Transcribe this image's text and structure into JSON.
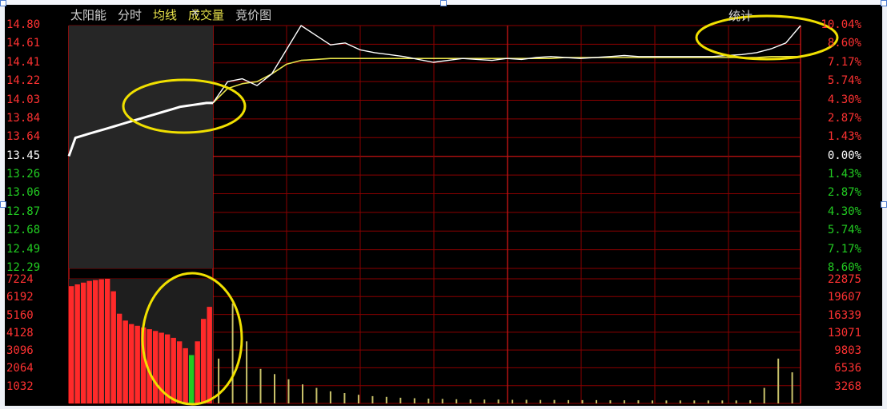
{
  "header": {
    "stock_name": "太阳能",
    "tab_time": "分时",
    "tab_avg": "均线",
    "tab_volume": "成交量",
    "tab_auction": "竞价图",
    "stat_label": "统计",
    "close_symbol": "×"
  },
  "price_axis": {
    "left": [
      {
        "text": "14.80",
        "tone": "red"
      },
      {
        "text": "14.61",
        "tone": "red"
      },
      {
        "text": "14.41",
        "tone": "red"
      },
      {
        "text": "14.22",
        "tone": "red"
      },
      {
        "text": "14.03",
        "tone": "red"
      },
      {
        "text": "13.84",
        "tone": "red"
      },
      {
        "text": "13.64",
        "tone": "red"
      },
      {
        "text": "13.45",
        "tone": "white"
      },
      {
        "text": "13.26",
        "tone": "green"
      },
      {
        "text": "13.06",
        "tone": "green"
      },
      {
        "text": "12.87",
        "tone": "green"
      },
      {
        "text": "12.68",
        "tone": "green"
      },
      {
        "text": "12.49",
        "tone": "green"
      },
      {
        "text": "12.29",
        "tone": "green"
      }
    ],
    "right": [
      {
        "text": "10.04%",
        "tone": "red"
      },
      {
        "text": "8.60%",
        "tone": "red"
      },
      {
        "text": "7.17%",
        "tone": "red"
      },
      {
        "text": "5.74%",
        "tone": "red"
      },
      {
        "text": "4.30%",
        "tone": "red"
      },
      {
        "text": "2.87%",
        "tone": "red"
      },
      {
        "text": "1.43%",
        "tone": "red"
      },
      {
        "text": "0.00%",
        "tone": "white"
      },
      {
        "text": "1.43%",
        "tone": "green"
      },
      {
        "text": "2.87%",
        "tone": "green"
      },
      {
        "text": "4.30%",
        "tone": "green"
      },
      {
        "text": "5.74%",
        "tone": "green"
      },
      {
        "text": "7.17%",
        "tone": "green"
      },
      {
        "text": "8.60%",
        "tone": "green"
      }
    ]
  },
  "volume_axis": {
    "left": [
      "7224",
      "6192",
      "5160",
      "4128",
      "3096",
      "2064",
      "1032"
    ],
    "right": [
      "22875",
      "19607",
      "16339",
      "13071",
      "9803",
      "6536",
      "3268"
    ]
  },
  "colors": {
    "grid": "#8b0000",
    "price_line": "#ffffff",
    "avg_line": "#e8e24a",
    "up_bar": "#ff2a2a",
    "down_bar": "#22cc22",
    "highlight": "#f0e000",
    "vol_bar": "#c9c26a"
  },
  "chart_data": {
    "type": "line",
    "title": "",
    "xlabel": "",
    "ylabel": "",
    "ylim": [
      12.29,
      14.8
    ],
    "prev_close": 13.45,
    "auction_price": [
      13.45,
      13.64,
      13.66,
      13.68,
      13.7,
      13.72,
      13.74,
      13.76,
      13.78,
      13.8,
      13.82,
      13.84,
      13.86,
      13.88,
      13.9,
      13.92,
      13.94,
      13.96,
      13.97,
      13.98,
      13.99,
      14.0,
      14.0
    ],
    "intraday_price": [
      14.0,
      14.22,
      14.25,
      14.18,
      14.3,
      14.55,
      14.8,
      14.7,
      14.6,
      14.62,
      14.55,
      14.52,
      14.5,
      14.48,
      14.45,
      14.42,
      14.44,
      14.46,
      14.45,
      14.44,
      14.46,
      14.45,
      14.47,
      14.48,
      14.47,
      14.46,
      14.47,
      14.48,
      14.49,
      14.48,
      14.48,
      14.48,
      14.48,
      14.48,
      14.48,
      14.49,
      14.5,
      14.52,
      14.56,
      14.62,
      14.8
    ],
    "intraday_avg": [
      14.0,
      14.15,
      14.2,
      14.22,
      14.3,
      14.4,
      14.44,
      14.45,
      14.46,
      14.46,
      14.46,
      14.46,
      14.46,
      14.46,
      14.46,
      14.46,
      14.46,
      14.46,
      14.46,
      14.46,
      14.46,
      14.46,
      14.46,
      14.46,
      14.47,
      14.47,
      14.47,
      14.47,
      14.47,
      14.47,
      14.47,
      14.47,
      14.47,
      14.47,
      14.47,
      14.47,
      14.47,
      14.47,
      14.48,
      14.48,
      14.48
    ],
    "volume_ylim": [
      0,
      7224
    ],
    "auction_volume": [
      6800,
      6900,
      7000,
      7100,
      7150,
      7200,
      7224,
      6500,
      5200,
      4800,
      4600,
      4500,
      4400,
      4300,
      4200,
      4100,
      4000,
      3800,
      3600,
      3200,
      2800,
      3600,
      4900,
      5600
    ],
    "intraday_volume": [
      2600,
      5800,
      3600,
      2000,
      1700,
      1400,
      1100,
      900,
      700,
      600,
      500,
      420,
      380,
      330,
      300,
      280,
      260,
      240,
      230,
      220,
      220,
      210,
      210,
      200,
      200,
      190,
      190,
      190,
      180,
      180,
      180,
      170,
      170,
      170,
      170,
      170,
      170,
      170,
      180,
      900,
      2600,
      1800
    ]
  }
}
